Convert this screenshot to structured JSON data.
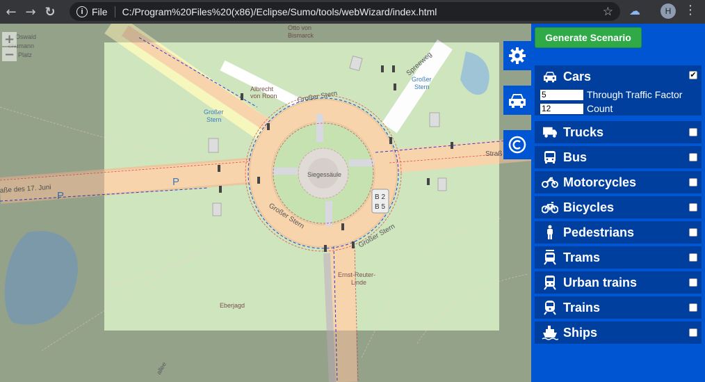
{
  "browser": {
    "file_label": "File",
    "url": "C:/Program%20Files%20(x86)/Eclipse/Sumo/tools/webWizard/index.html",
    "avatar_initial": "H"
  },
  "map": {
    "labels": {
      "grosser_stern_top": "Großer Stern",
      "grosser_stern_bottom": "Großer Stern",
      "grosser_stern_right": "Großer Stern",
      "siegessaeule": "Siegessäule",
      "albrecht": "Albrecht",
      "von_roon": "von Roon",
      "otto_von": "Otto von",
      "bismarck": "Bismarck",
      "spreeweg": "Spreeweg",
      "bus_left_1": "Großer",
      "bus_left_2": "Stern",
      "bus_right_1": "Großer",
      "bus_right_2": "Stern",
      "strasse_17_juni": "aße des 17. Juni",
      "strasse_right": "Straß",
      "ernst_reuter_1": "Ernst-Reuter-",
      "ernst_reuter_2": "Linde",
      "eberjagd": "Eberjagd",
      "oswald": "Oswald",
      "chumann": "chumann",
      "platz": "Platz",
      "b2": "B 2",
      "b5": "B 5",
      "parking": "P",
      "allee": "allee"
    }
  },
  "panel": {
    "generate_label": "Generate Scenario",
    "vehicles": [
      {
        "name": "Cars",
        "icon": "car-icon",
        "checked": true,
        "options": [
          {
            "value": "5",
            "label": "Through Traffic Factor"
          },
          {
            "value": "12",
            "label": "Count"
          }
        ]
      },
      {
        "name": "Trucks",
        "icon": "truck-icon",
        "checked": false
      },
      {
        "name": "Bus",
        "icon": "bus-icon",
        "checked": false
      },
      {
        "name": "Motorcycles",
        "icon": "motorcycle-icon",
        "checked": false
      },
      {
        "name": "Bicycles",
        "icon": "bicycle-icon",
        "checked": false
      },
      {
        "name": "Pedestrians",
        "icon": "pedestrian-icon",
        "checked": false
      },
      {
        "name": "Trams",
        "icon": "tram-icon",
        "checked": false
      },
      {
        "name": "Urban trains",
        "icon": "urban-train-icon",
        "checked": false
      },
      {
        "name": "Trains",
        "icon": "train-icon",
        "checked": false
      },
      {
        "name": "Ships",
        "icon": "ship-icon",
        "checked": false
      }
    ]
  }
}
